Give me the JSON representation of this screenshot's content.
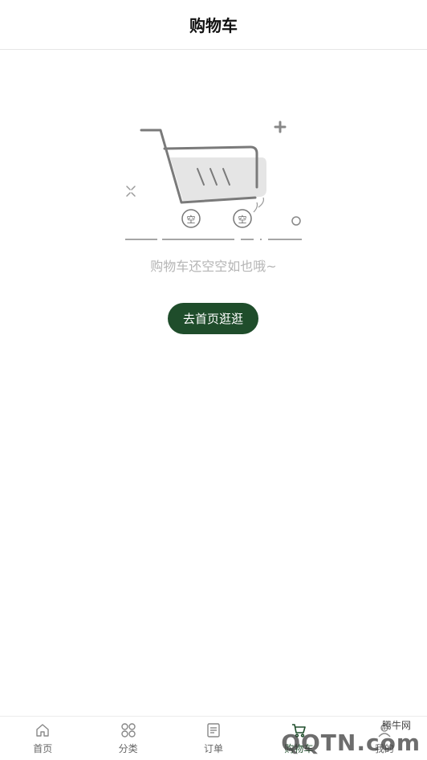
{
  "header": {
    "title": "购物车"
  },
  "empty_state": {
    "wheel_text_left": "空",
    "wheel_text_right": "空",
    "message": "购物车还空空如也哦~",
    "button_label": "去首页逛逛"
  },
  "tabbar": {
    "items": [
      {
        "label": "首页",
        "icon": "home-icon"
      },
      {
        "label": "分类",
        "icon": "category-icon"
      },
      {
        "label": "订单",
        "icon": "order-icon"
      },
      {
        "label": "购物车",
        "icon": "cart-icon",
        "active": true
      },
      {
        "label": "我的",
        "icon": "user-icon"
      }
    ]
  },
  "watermark": {
    "cn": "腾牛网",
    "latin": "QQTN.com"
  },
  "colors": {
    "accent": "#1f4d2b",
    "muted_text": "#b5b5b5",
    "divider": "#e6e6e6"
  }
}
